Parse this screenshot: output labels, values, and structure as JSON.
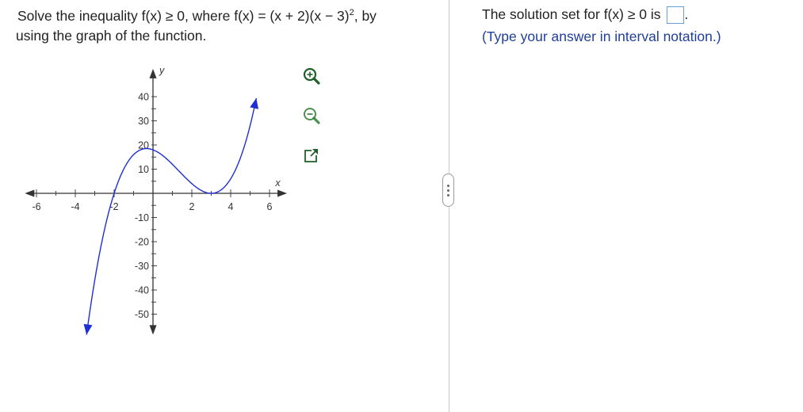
{
  "question": {
    "prefix": "Solve the inequality f(x) ≥ 0, where f(x) = (x + 2)(x − 3)",
    "exponent": "2",
    "suffix": ", by",
    "line2": "using the graph of the function."
  },
  "chart_data": {
    "type": "line",
    "function": "f(x) = (x + 2)(x − 3)^2",
    "x_range": [
      -6.5,
      7
    ],
    "y_range": [
      -55,
      50
    ],
    "x_ticks": [
      -6,
      -4,
      -2,
      2,
      4,
      6
    ],
    "y_ticks": [
      40,
      30,
      20,
      10,
      -10,
      -20,
      -30,
      -40,
      -50
    ],
    "x_tick_labels": [
      "-6",
      "-4",
      "-2",
      "2",
      "4",
      "6"
    ],
    "y_tick_labels": [
      "40",
      "30",
      "20",
      "10",
      "-10",
      "-20",
      "-30",
      "-40",
      "-50"
    ],
    "xlabel": "x",
    "ylabel": "y",
    "curve_color": "#1f2fd6",
    "curve_x_range": [
      -3.42,
      5.32
    ],
    "series": [
      {
        "x": [
          -3.4,
          -3,
          -2,
          -1,
          0,
          1,
          2,
          3,
          4,
          5,
          5.3
        ],
        "y": [
          -54.9,
          -36,
          0,
          16,
          18,
          12,
          4,
          0,
          6,
          28,
          38.6
        ]
      }
    ],
    "grid": false
  },
  "tools": {
    "zoom_in": "zoom-in-icon",
    "zoom_out": "zoom-out-icon",
    "popout": "popout-icon"
  },
  "answer": {
    "prefix": "The solution set for f(x) ≥ 0 is",
    "period": ".",
    "hint": "(Type your answer in interval notation.)",
    "value": ""
  },
  "colors": {
    "accent_blue": "#1f3f99",
    "curve": "#1f2fd6",
    "input_border": "#6aa0d8",
    "icon_green": "#2e7d32",
    "divider": "#c9c9c9"
  }
}
